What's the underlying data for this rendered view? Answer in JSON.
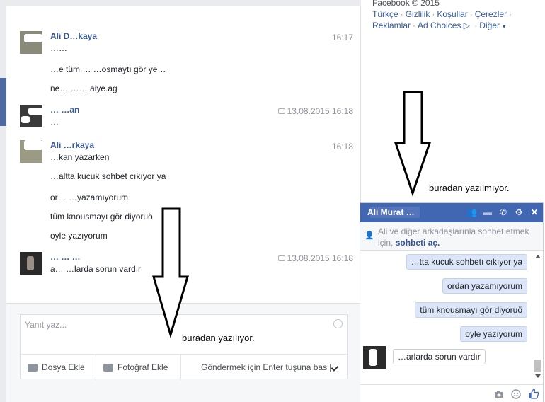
{
  "footer": {
    "copyright": "Facebook © 2015",
    "links_row1": [
      "Türkçe",
      "Gizlilik",
      "Koşullar",
      "Çerezler"
    ],
    "links_row2": [
      "Reklamlar",
      "Ad Choices",
      "Diğer"
    ]
  },
  "thread": {
    "groups": [
      {
        "sender": "Ali D…kaya",
        "time": "16:17",
        "lines": [
          "……",
          "…e tüm … …osmaytı gör ye…",
          "ne… …… aiye.ag"
        ]
      },
      {
        "sender": "… …an",
        "time": "13.08.2015 16:18",
        "lines": [
          "…"
        ]
      },
      {
        "sender": "Ali …rkaya",
        "time": "16:18",
        "lines": [
          "…kan yazarken",
          "…altta kucuk sohbet cıkıyor ya",
          "or… …yazamıyorum",
          "tüm knousmayı gör diyoruö",
          "oyle yazıyorum"
        ]
      },
      {
        "sender": "… … …",
        "time": "13.08.2015 16:18",
        "lines": [
          "a… …larda sorun vardır"
        ]
      }
    ]
  },
  "composer": {
    "placeholder": "Yanıt yaz...",
    "attach_label": "Dosya Ekle",
    "photo_label": "Fotoğraf Ekle",
    "enter_label": "Göndermek için Enter tuşuna bas"
  },
  "chat": {
    "title": "Ali Murat …",
    "notice_text": "Ali ve diğer arkadaşlarınla sohbet etmek için,",
    "notice_link": "sohbeti aç.",
    "messages_out": [
      "…tta kucuk sohbetı cıkıyor ya",
      "ordan yazamıyorum",
      "tüm knousmayı gör diyoruö",
      "oyle yazıyorum"
    ],
    "message_in": "…arlarda sorun vardır"
  },
  "annotations": {
    "right": "buradan yazılmıyor.",
    "bottom": "buradan yazılıyor."
  },
  "colors": {
    "facebook_blue": "#4267b2",
    "link_blue": "#365899",
    "bubble_blue": "#dce6f8"
  }
}
